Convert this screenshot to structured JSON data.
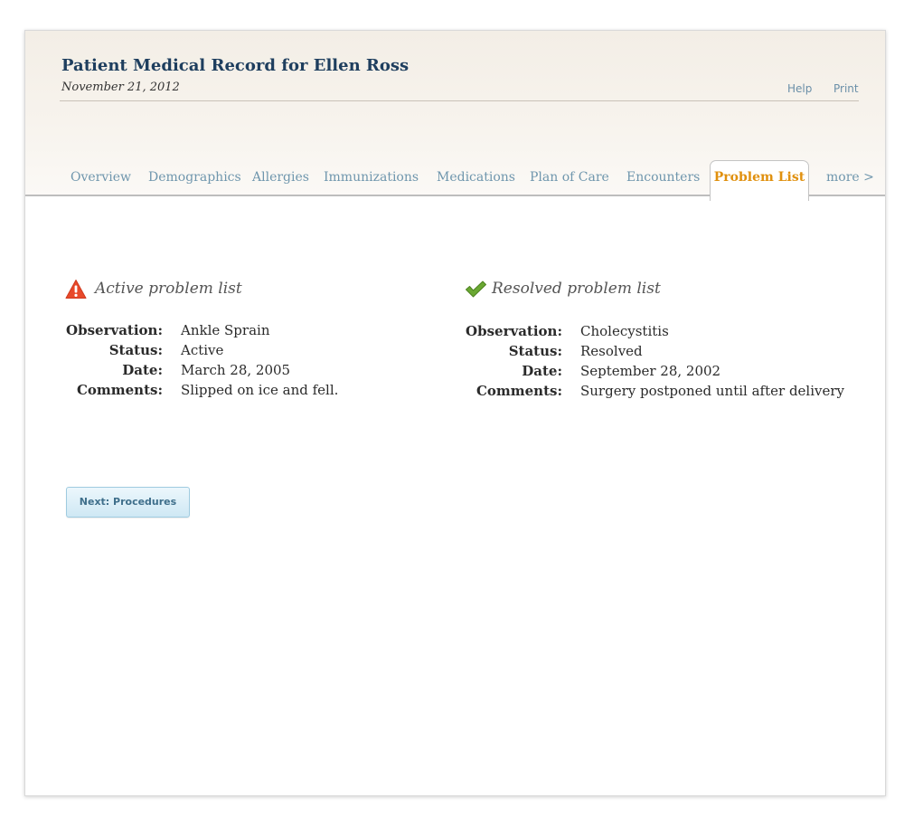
{
  "header": {
    "title": "Patient Medical Record for Ellen Ross",
    "date": "November 21, 2012",
    "links": {
      "help": "Help",
      "print": "Print"
    }
  },
  "tabs": {
    "items": [
      "Overview",
      "Demographics",
      "Allergies",
      "Immunizations",
      "Medications",
      "Plan of Care",
      "Encounters"
    ],
    "active": "Problem List",
    "more": "more >"
  },
  "active_problems": {
    "heading": "Active problem list",
    "icon": "warning-icon",
    "fields": {
      "observation": {
        "label": "Observation:",
        "value": "Ankle Sprain"
      },
      "status": {
        "label": "Status:",
        "value": "Active"
      },
      "date": {
        "label": "Date:",
        "value": "March 28, 2005"
      },
      "comments": {
        "label": "Comments:",
        "value": "Slipped on ice and fell."
      }
    }
  },
  "resolved_problems": {
    "heading": "Resolved problem list",
    "icon": "checkmark-icon",
    "fields": {
      "observation": {
        "label": "Observation:",
        "value": "Cholecystitis"
      },
      "status": {
        "label": "Status:",
        "value": "Resolved"
      },
      "date": {
        "label": "Date:",
        "value": "September 28, 2002"
      },
      "comments": {
        "label": "Comments:",
        "value": "Surgery postponed until after delivery"
      }
    }
  },
  "actions": {
    "next_label": "Next: Procedures"
  },
  "colors": {
    "title": "#1e3e5e",
    "tab_link": "#6f96ad",
    "tab_active": "#e0900e",
    "warning": "#e8492a",
    "check": "#5f9a2a"
  }
}
